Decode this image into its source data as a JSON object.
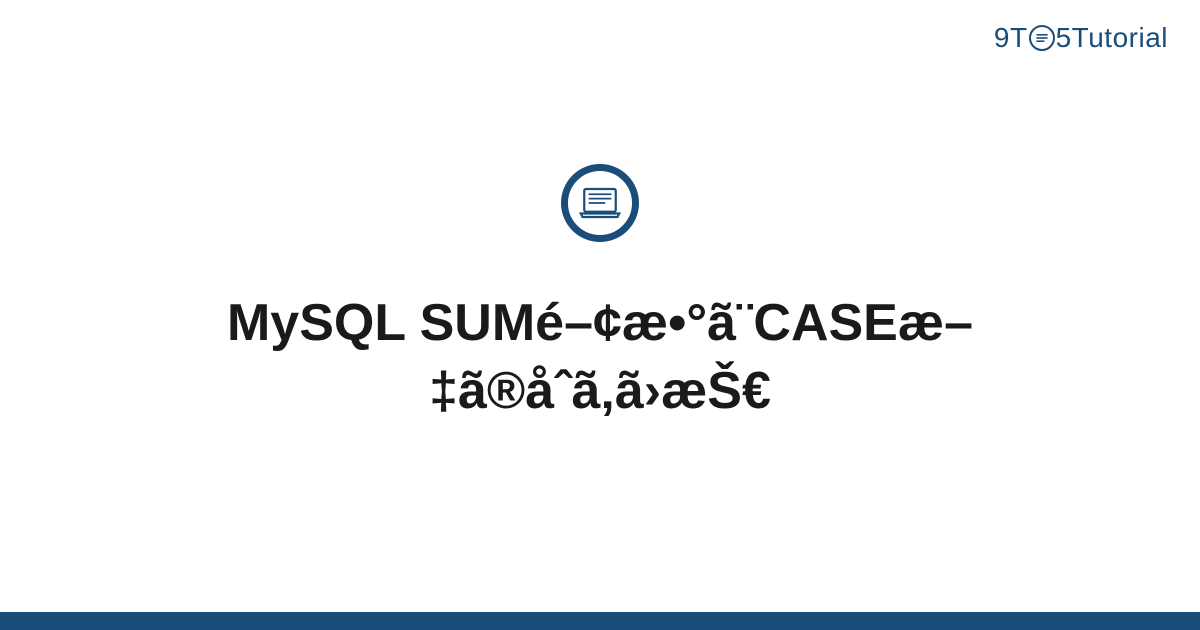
{
  "logo": {
    "part1": "9T",
    "part2": "5",
    "part3": "Tutorial"
  },
  "page_title": "MySQL SUMé–¢æ•°ã¨CASEæ–‡ã®åˆã‚ã›æŠ€",
  "colors": {
    "brand": "#1a4d7a",
    "text": "#1a1a1a"
  }
}
